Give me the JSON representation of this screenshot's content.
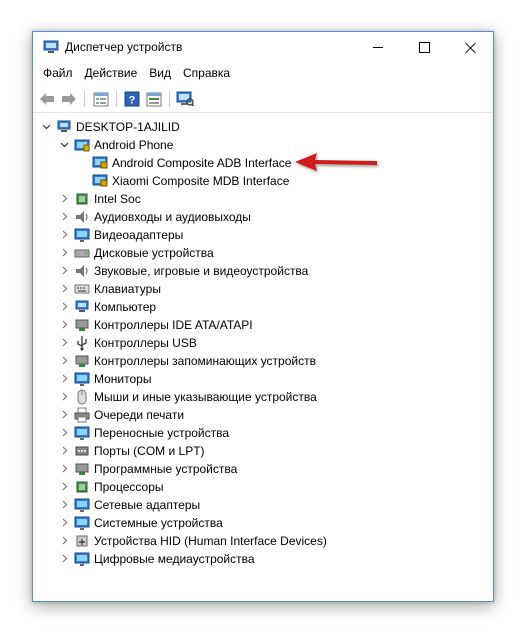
{
  "window": {
    "title": "Диспетчер устройств"
  },
  "menu": [
    "Файл",
    "Действие",
    "Вид",
    "Справка"
  ],
  "toolbar": {
    "buttons": [
      "back-icon",
      "forward-icon",
      "properties-icon",
      "help-icon",
      "view-icon",
      "scan-hardware-icon"
    ]
  },
  "tree": {
    "root": "DESKTOP-1AJILID",
    "android_group": "Android Phone",
    "android_devices": [
      "Android Composite ADB Interface",
      "Xiaomi Composite MDB Interface"
    ],
    "categories": [
      "Intel Soc",
      "Аудиовходы и аудиовыходы",
      "Видеоадаптеры",
      "Дисковые устройства",
      "Звуковые, игровые и видеоустройства",
      "Клавиатуры",
      "Компьютер",
      "Контроллеры IDE ATA/ATAPI",
      "Контроллеры USB",
      "Контроллеры запоминающих устройств",
      "Мониторы",
      "Мыши и иные указывающие устройства",
      "Очереди печати",
      "Переносные устройства",
      "Порты (COM и LPT)",
      "Программные устройства",
      "Процессоры",
      "Сетевые адаптеры",
      "Системные устройства",
      "Устройства HID (Human Interface Devices)",
      "Цифровые медиаустройства"
    ]
  },
  "colors": {
    "accent_arrow": "#d11a1a",
    "window_border": "#5a8fcf"
  }
}
